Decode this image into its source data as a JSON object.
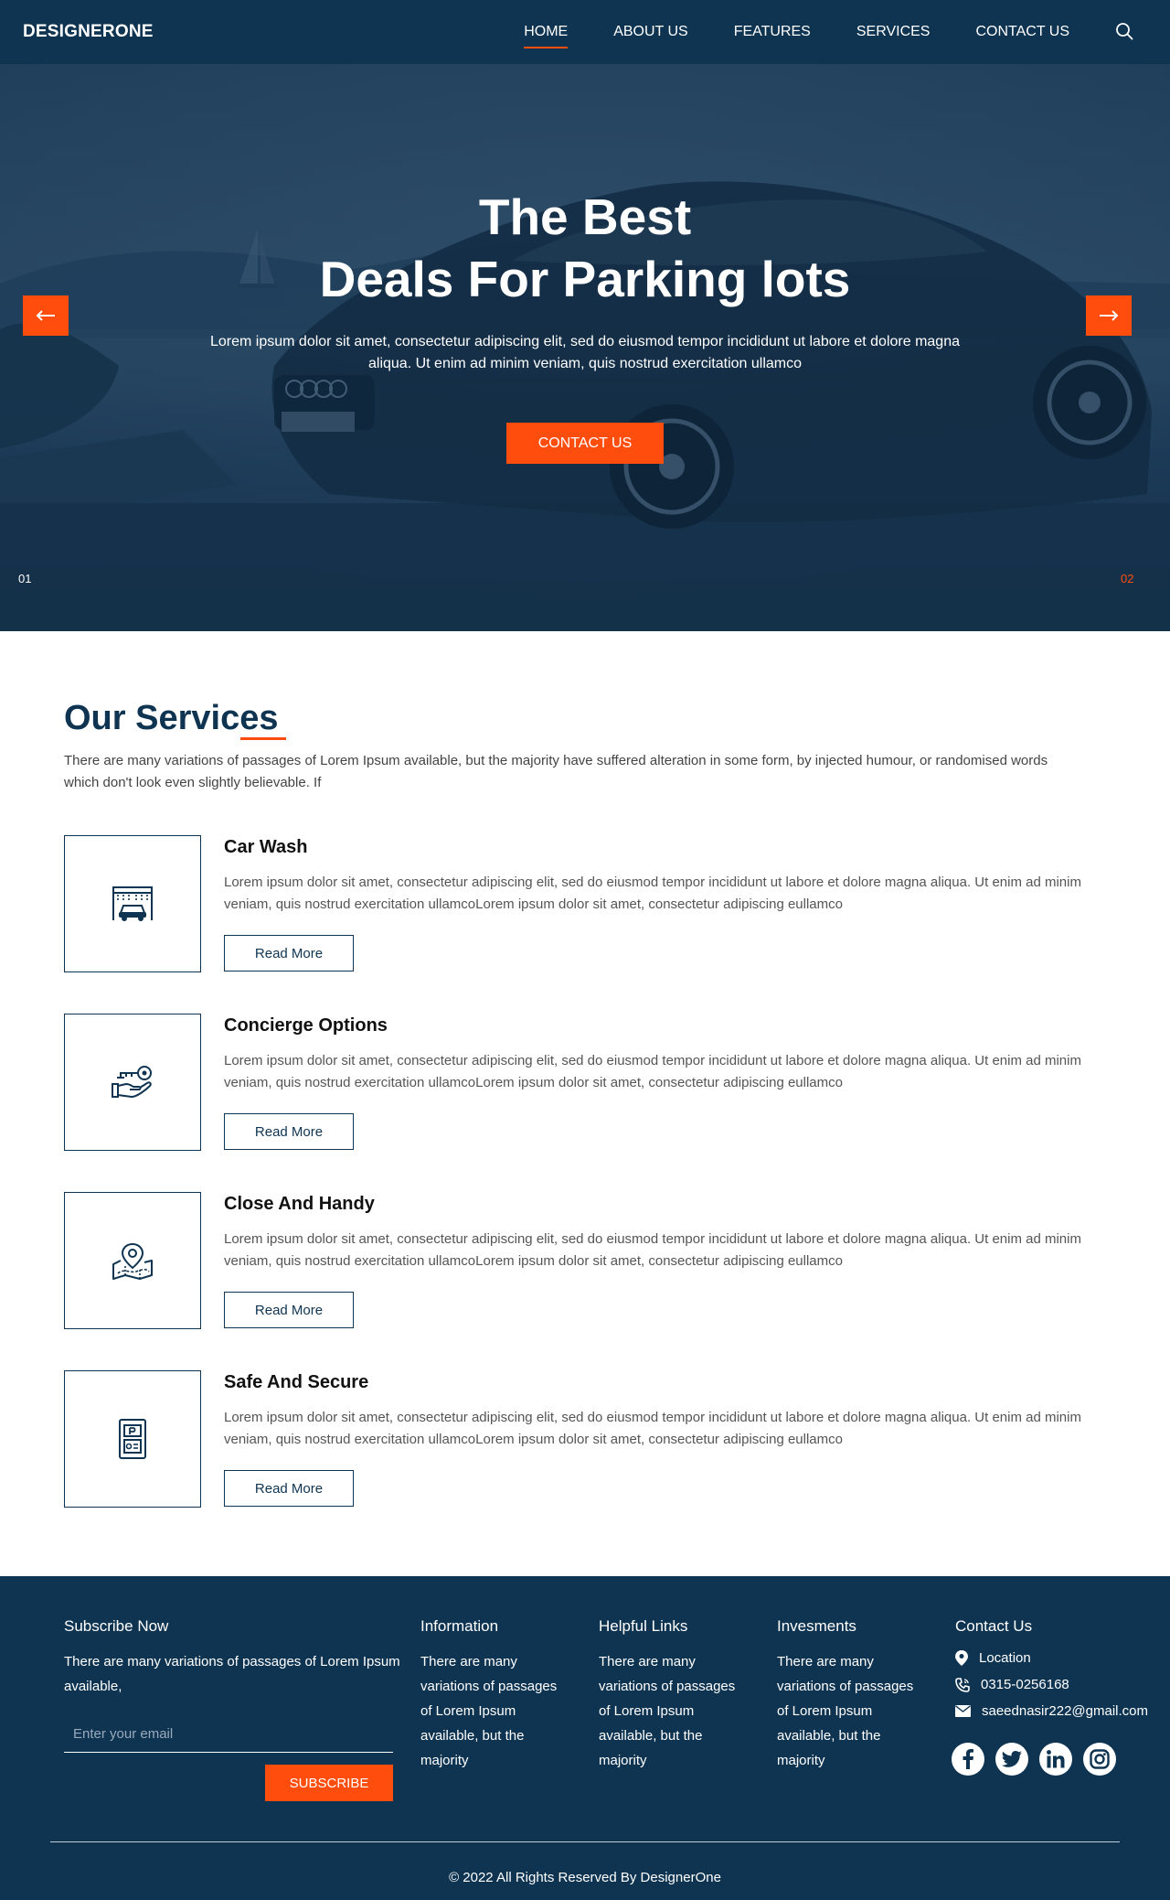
{
  "nav": {
    "brand": "DESIGNERONE",
    "links": [
      "HOME",
      "ABOUT US",
      "FEATURES",
      "SERVICES",
      "CONTACT US"
    ],
    "active": "HOME"
  },
  "hero": {
    "title_line1": "The Best",
    "title_line2": "Deals For Parking lots",
    "text": "Lorem ipsum dolor sit amet, consectetur adipiscing elit, sed do eiusmod tempor incididunt ut labore et dolore magna aliqua. Ut enim ad minim veniam, quis nostrud exercitation ullamco",
    "cta": "CONTACT US",
    "slide_current": "01",
    "slide_next": "02"
  },
  "services": {
    "title": "Our Services",
    "intro": "There are many variations of passages of Lorem Ipsum available, but the majority have suffered alteration in some form, by injected humour, or randomised words which don't look even slightly believable. If",
    "items": [
      {
        "title": "Car Wash",
        "icon": "car-wash-icon",
        "text": "Lorem ipsum dolor sit amet, consectetur adipiscing elit, sed do eiusmod tempor incididunt ut labore et dolore magna aliqua. Ut enim ad minim veniam, quis nostrud exercitation ullamcoLorem ipsum dolor sit amet, consectetur adipiscing eullamco",
        "button": "Read More"
      },
      {
        "title": "Concierge Options",
        "icon": "key-in-hand-icon",
        "text": "Lorem ipsum dolor sit amet, consectetur adipiscing elit, sed do eiusmod tempor incididunt ut labore et dolore magna aliqua. Ut enim ad minim veniam, quis nostrud exercitation ullamcoLorem ipsum dolor sit amet, consectetur adipiscing eullamco",
        "button": "Read More"
      },
      {
        "title": "Close And Handy",
        "icon": "map-pin-icon",
        "text": "Lorem ipsum dolor sit amet, consectetur adipiscing elit, sed do eiusmod tempor incididunt ut labore et dolore magna aliqua. Ut enim ad minim veniam, quis nostrud exercitation ullamcoLorem ipsum dolor sit amet, consectetur adipiscing eullamco",
        "button": "Read More"
      },
      {
        "title": "Safe And Secure",
        "icon": "parking-ticket-machine-icon",
        "text": "Lorem ipsum dolor sit amet, consectetur adipiscing elit, sed do eiusmod tempor incididunt ut labore et dolore magna aliqua. Ut enim ad minim veniam, quis nostrud exercitation ullamcoLorem ipsum dolor sit amet, consectetur adipiscing eullamco",
        "button": "Read More"
      }
    ]
  },
  "footer": {
    "subscribe": {
      "title": "Subscribe Now",
      "text": "There are many variations of passages of Lorem Ipsum available,",
      "placeholder": "Enter your email",
      "button": "SUBSCRIBE"
    },
    "columns": [
      {
        "title": "Information",
        "text": "There are many variations of passages of Lorem Ipsum available, but the majority"
      },
      {
        "title": "Helpful Links",
        "text": "There are many variations of passages of Lorem Ipsum available, but the majority"
      },
      {
        "title": "Invesments",
        "text": "There are many variations of passages of Lorem Ipsum available, but the majority"
      }
    ],
    "contact": {
      "title": "Contact Us",
      "location": "Location",
      "phone": "0315-0256168",
      "email": "saeednasir222@gmail.com"
    },
    "social": [
      "facebook-icon",
      "twitter-icon",
      "linkedin-icon",
      "instagram-icon"
    ],
    "copyright": "© 2022 All Rights Reserved By DesignerOne"
  },
  "colors": {
    "navy": "#0f3451",
    "accent": "#ff4d0d",
    "white": "#ffffff"
  }
}
